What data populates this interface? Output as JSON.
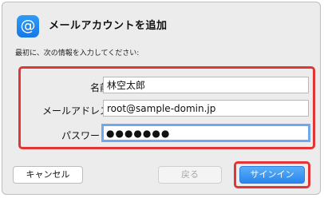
{
  "dialog": {
    "icon_glyph": "@",
    "icon_name": "mail-account-icon",
    "title": "メールアカウントを追加",
    "instruction": "最初に、次の情報を入力してください:"
  },
  "form": {
    "name_label": "名前:",
    "name_value": "林空太郎",
    "email_label": "メールアドレス:",
    "email_value": "root@sample-domin.jp",
    "password_label": "パスワード:",
    "password_masked": "●●●●●●●"
  },
  "buttons": {
    "cancel": "キャンセル",
    "back": "戻る",
    "signin": "サインイン"
  },
  "colors": {
    "highlight": "#e23535",
    "primary": "#2a86ef",
    "focus_ring": "#6ea8f0"
  }
}
